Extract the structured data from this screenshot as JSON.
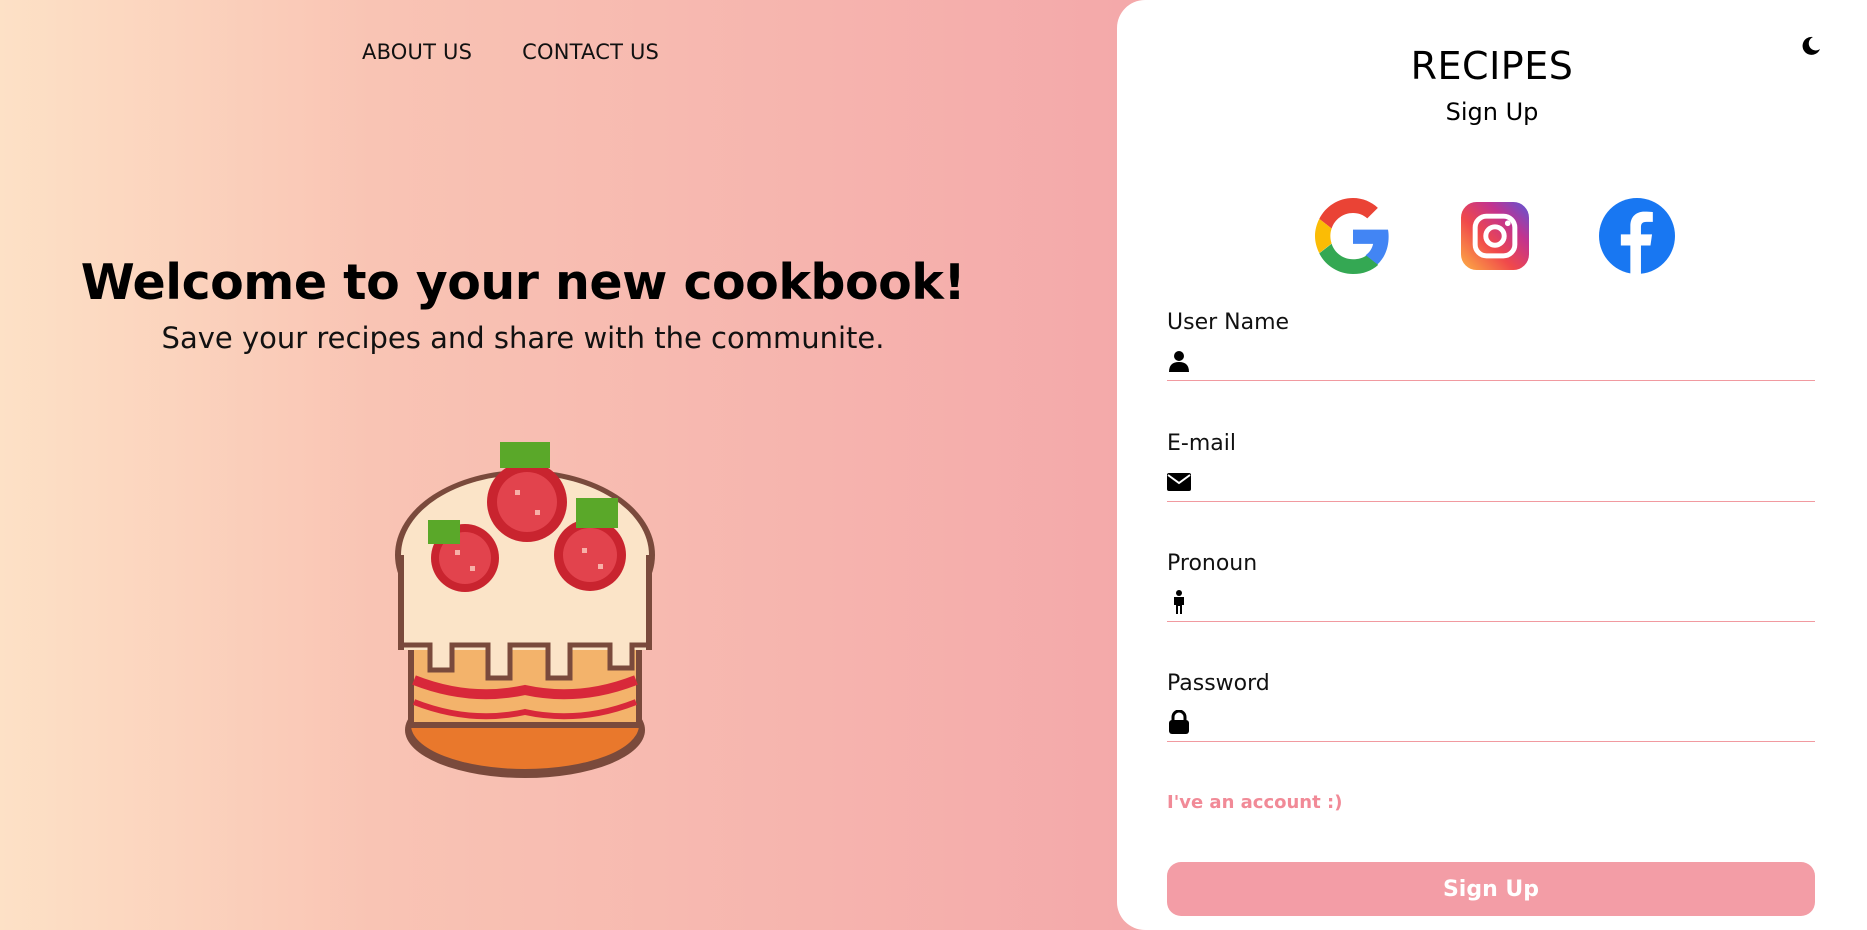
{
  "nav": {
    "about": "ABOUT US",
    "contact": "CONTACT US"
  },
  "hero": {
    "title": "Welcome to your new cookbook!",
    "subtitle": "Save your recipes and share with the communite."
  },
  "card": {
    "brand": "RECIPES",
    "subtitle": "Sign Up",
    "socials": [
      "google-icon",
      "instagram-icon",
      "facebook-icon"
    ],
    "fields": {
      "username": {
        "label": "User Name",
        "value": "",
        "icon": "user-icon"
      },
      "email": {
        "label": "E-mail",
        "value": "",
        "icon": "envelope-icon"
      },
      "pronoun": {
        "label": "Pronoun",
        "value": "",
        "icon": "person-icon"
      },
      "password": {
        "label": "Password",
        "value": "",
        "icon": "lock-icon"
      }
    },
    "login_link": "I've an account :)",
    "signup_button": "Sign Up"
  },
  "colors": {
    "accent": "#f39da6",
    "link": "#f18a97",
    "gradient_start": "#fde1c6",
    "gradient_end": "#f39da2"
  }
}
